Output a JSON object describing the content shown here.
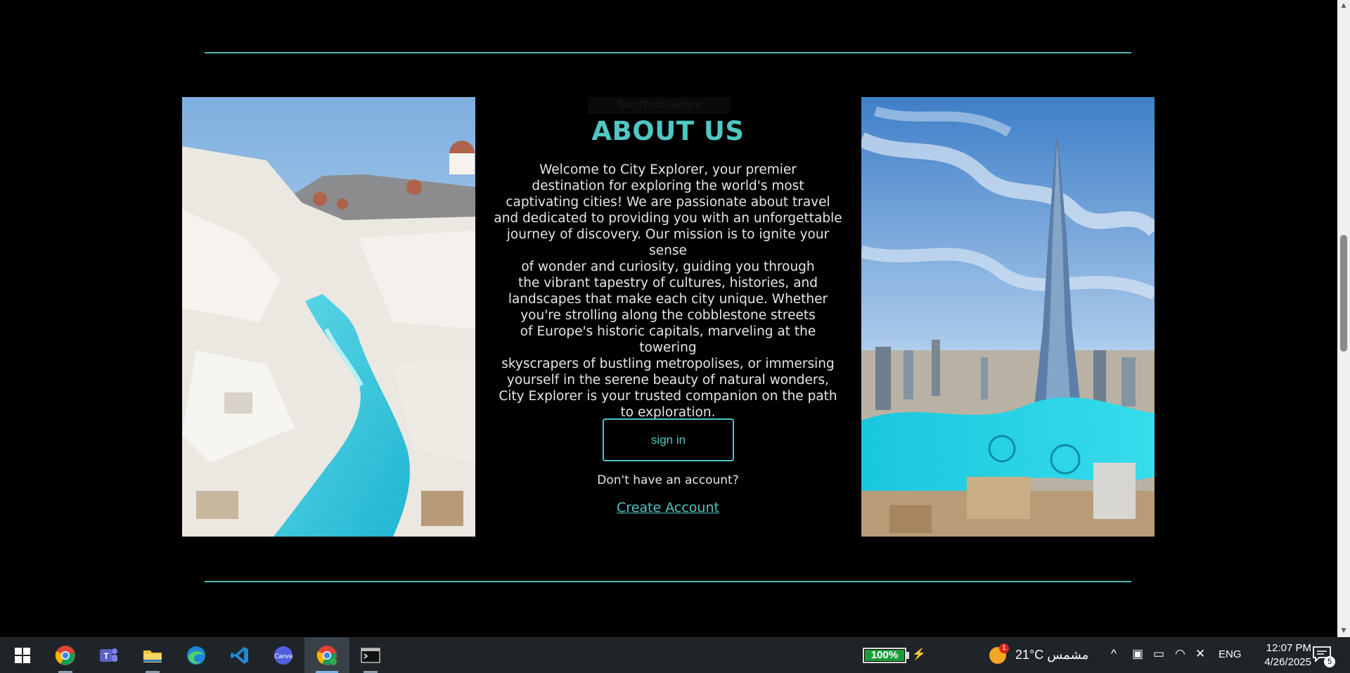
{
  "page": {
    "faint_label": "Tour Photo Gallery",
    "about_title": "ABOUT US",
    "about_lines": [
      "Welcome to City Explorer, your premier",
      "destination for exploring the world's most",
      "captivating cities! We are passionate about travel",
      "and dedicated to providing you with an unforgettable",
      "journey of discovery. Our mission is to ignite your sense",
      "of wonder and curiosity, guiding you through",
      "the vibrant tapestry of cultures, histories, and",
      "landscapes that make each city unique. Whether",
      "you're strolling along the cobblestone streets",
      "of Europe's historic capitals, marveling at the towering",
      "skyscrapers of bustling metropolises, or immersing",
      "yourself in the serene beauty of natural wonders,",
      "City Explorer is your trusted companion on the path",
      "to exploration."
    ],
    "signin_label": "sign in",
    "no_account_text": "Don't have an account?",
    "create_account_label": "Create Account",
    "left_image": "santorini-pool-photo",
    "right_image": "burj-khalifa-dubai-photo"
  },
  "colors": {
    "accent": "#4fc6c4",
    "background": "#000000",
    "text": "#e6e6e6",
    "taskbar": "#1f2429",
    "battery_green": "#1b9e3a"
  },
  "taskbar": {
    "apps": [
      {
        "name": "start-icon"
      },
      {
        "name": "chrome-icon"
      },
      {
        "name": "teams-icon"
      },
      {
        "name": "file-explorer-icon"
      },
      {
        "name": "edge-icon"
      },
      {
        "name": "vscode-icon"
      },
      {
        "name": "canva-icon"
      },
      {
        "name": "chrome-profile-icon"
      },
      {
        "name": "terminal-icon"
      }
    ],
    "battery": "100%",
    "weather_badge": "1",
    "weather": "21°C مشمس",
    "language": "ENG",
    "time": "12:07 PM",
    "date": "4/26/2025",
    "notifications": "5"
  }
}
